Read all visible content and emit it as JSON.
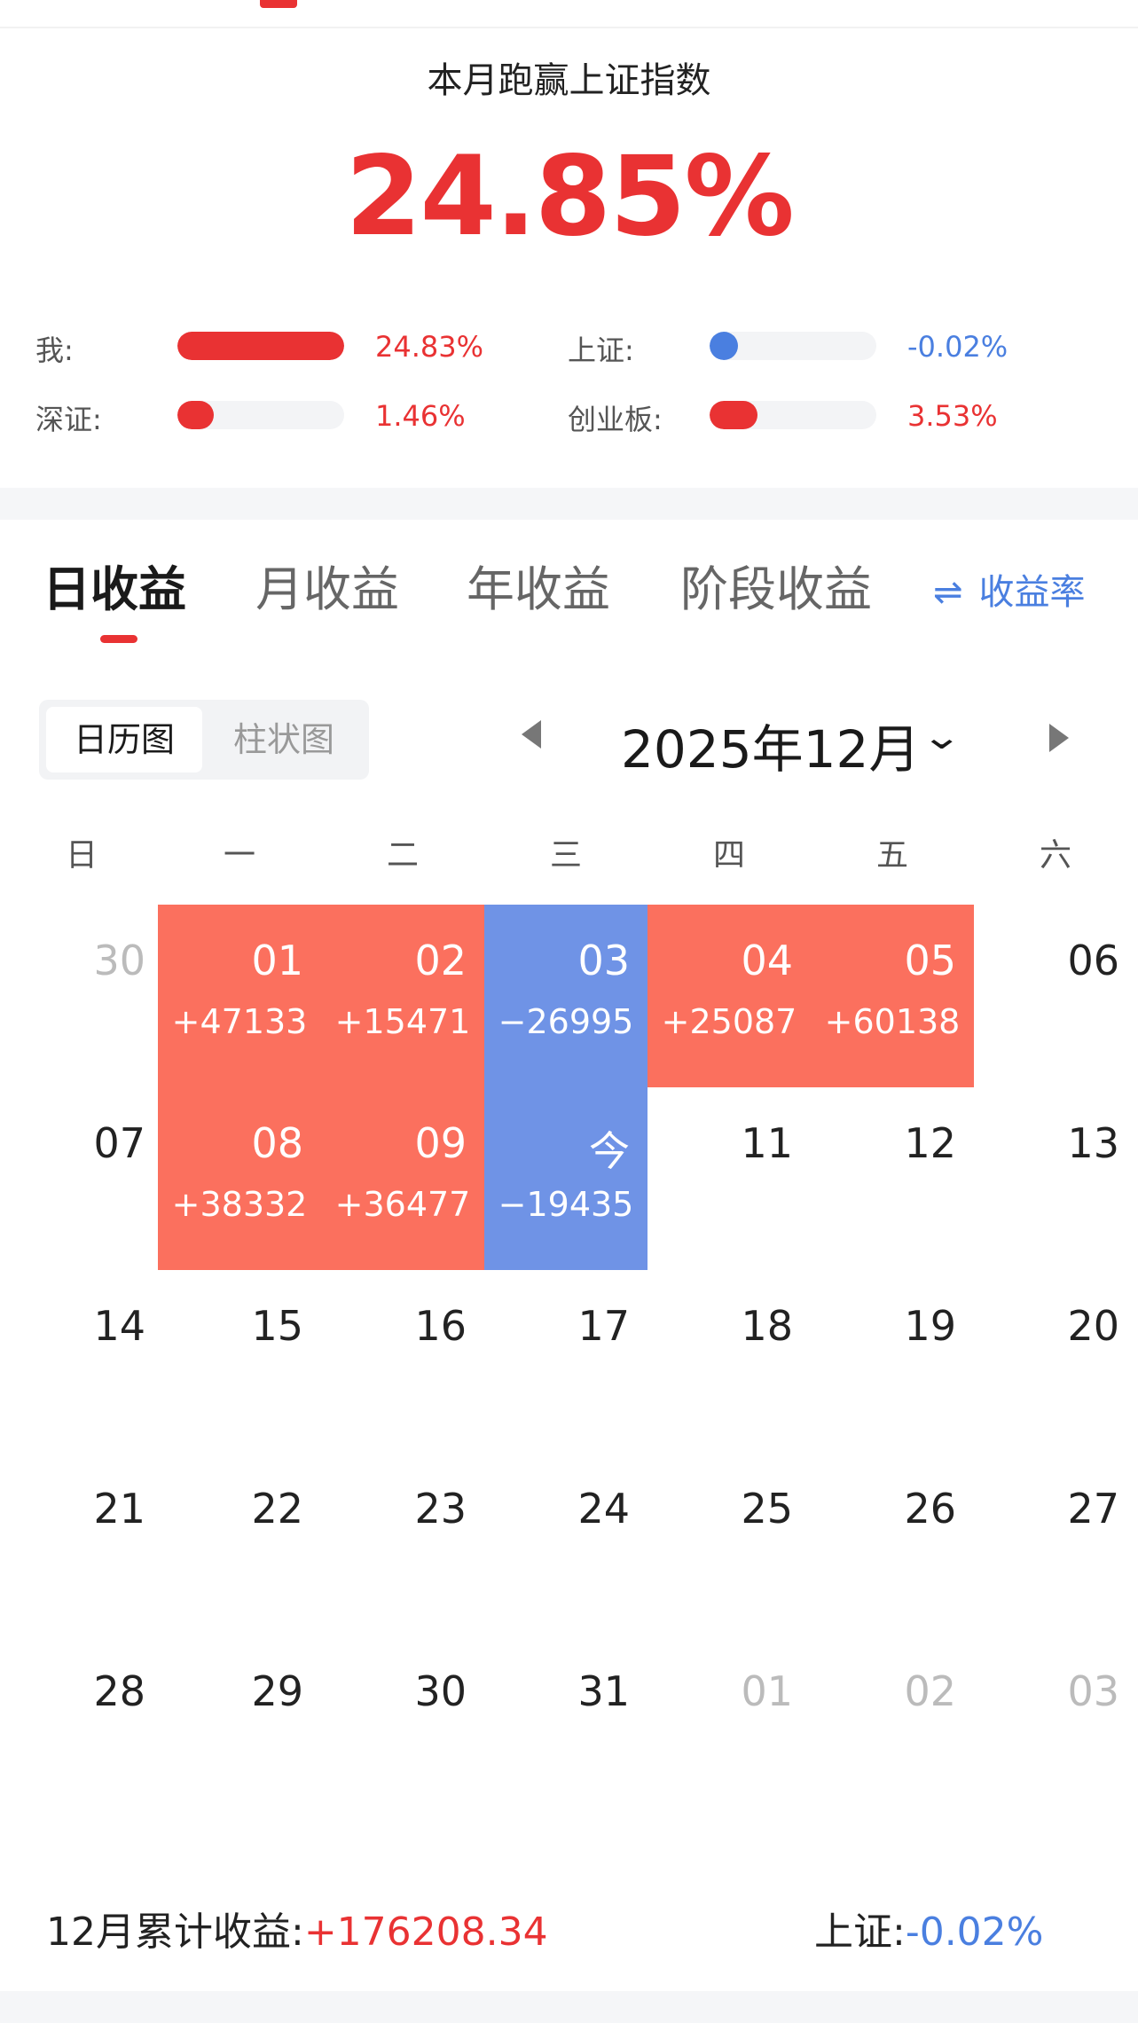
{
  "colors": {
    "red": "#e93233",
    "blue": "#4a7fe0",
    "gain_bg": "#fb705e",
    "loss_bg": "#6f93e6"
  },
  "summary": {
    "title": "本月跑赢上证指数",
    "value": "24.85%",
    "stats": [
      {
        "label": "我:",
        "value": "24.83%",
        "fill": 1.0,
        "color": "red"
      },
      {
        "label": "上证:",
        "value": "-0.02%",
        "fill": 0.0,
        "color": "blue"
      },
      {
        "label": "深证:",
        "value": "1.46%",
        "fill": 0.06,
        "color": "red"
      },
      {
        "label": "创业板:",
        "value": "3.53%",
        "fill": 0.14,
        "color": "red"
      }
    ]
  },
  "tabs": [
    {
      "label": "日收益",
      "active": true
    },
    {
      "label": "月收益",
      "active": false
    },
    {
      "label": "年收益",
      "active": false
    },
    {
      "label": "阶段收益",
      "active": false
    }
  ],
  "rate_toggle": {
    "icon": "swap-icon",
    "glyph": "⇌",
    "label": "收益率"
  },
  "view_switch": {
    "calendar": "日历图",
    "bar": "柱状图"
  },
  "month_nav": {
    "label": "2025年12月",
    "chevron": "⌄"
  },
  "weekdays": [
    "日",
    "一",
    "二",
    "三",
    "四",
    "五",
    "六"
  ],
  "calendar": {
    "weeks": [
      [
        {
          "day": "30",
          "muted": true
        },
        {
          "day": "01",
          "pnl": "+47133",
          "kind": "gain"
        },
        {
          "day": "02",
          "pnl": "+15471",
          "kind": "gain"
        },
        {
          "day": "03",
          "pnl": "−26995",
          "kind": "loss"
        },
        {
          "day": "04",
          "pnl": "+25087",
          "kind": "gain"
        },
        {
          "day": "05",
          "pnl": "+60138",
          "kind": "gain"
        },
        {
          "day": "06"
        }
      ],
      [
        {
          "day": "07"
        },
        {
          "day": "08",
          "pnl": "+38332",
          "kind": "gain"
        },
        {
          "day": "09",
          "pnl": "+36477",
          "kind": "gain"
        },
        {
          "day": "今",
          "pnl": "−19435",
          "kind": "loss"
        },
        {
          "day": "11"
        },
        {
          "day": "12"
        },
        {
          "day": "13"
        }
      ],
      [
        {
          "day": "14"
        },
        {
          "day": "15"
        },
        {
          "day": "16"
        },
        {
          "day": "17"
        },
        {
          "day": "18"
        },
        {
          "day": "19"
        },
        {
          "day": "20"
        }
      ],
      [
        {
          "day": "21"
        },
        {
          "day": "22"
        },
        {
          "day": "23"
        },
        {
          "day": "24"
        },
        {
          "day": "25"
        },
        {
          "day": "26"
        },
        {
          "day": "27"
        }
      ],
      [
        {
          "day": "28"
        },
        {
          "day": "29"
        },
        {
          "day": "30"
        },
        {
          "day": "31"
        },
        {
          "day": "01",
          "muted": true
        },
        {
          "day": "02",
          "muted": true
        },
        {
          "day": "03",
          "muted": true
        }
      ]
    ]
  },
  "footer": {
    "label": "12月累计收益:",
    "amount": "+176208.34",
    "index_label": "上证:",
    "index_value": "-0.02%"
  }
}
